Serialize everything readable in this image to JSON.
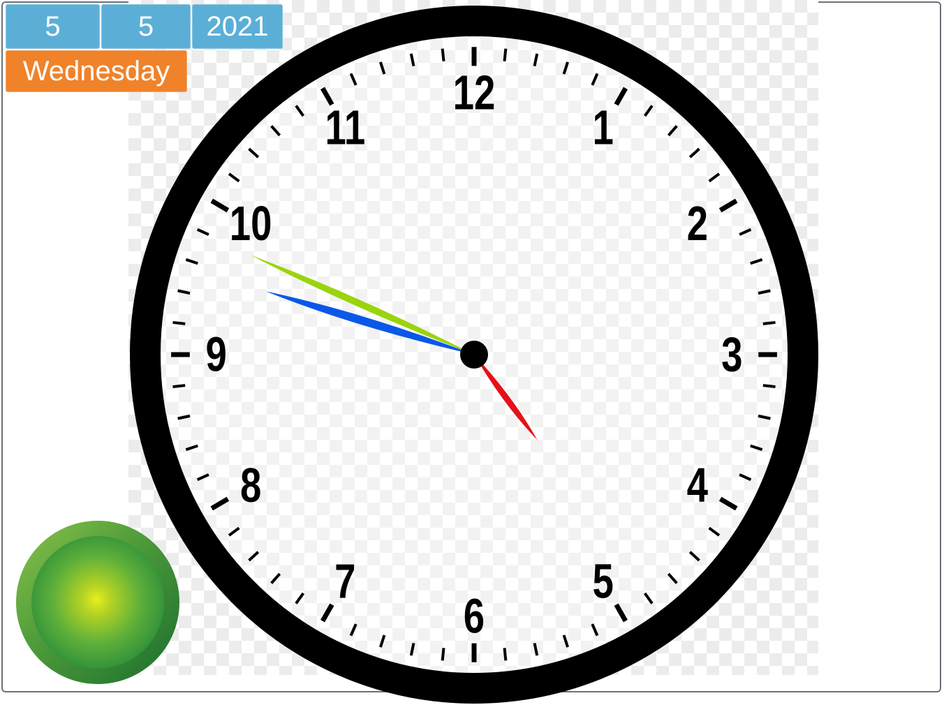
{
  "date": {
    "day": "5",
    "month": "5",
    "year": "2021",
    "weekday": "Wednesday"
  },
  "clock": {
    "numerals": [
      "12",
      "1",
      "2",
      "3",
      "4",
      "5",
      "6",
      "7",
      "8",
      "9",
      "10",
      "11"
    ],
    "time": {
      "hour": 4,
      "minute": 47,
      "second": 49
    },
    "hand_colors": {
      "hour": "#e6101a",
      "minute": "#0a58e8",
      "second": "#9ad40c"
    }
  },
  "status_light": {
    "color": "green"
  },
  "colors": {
    "date_field": "#5bafd6",
    "weekday_badge": "#f0822a"
  }
}
